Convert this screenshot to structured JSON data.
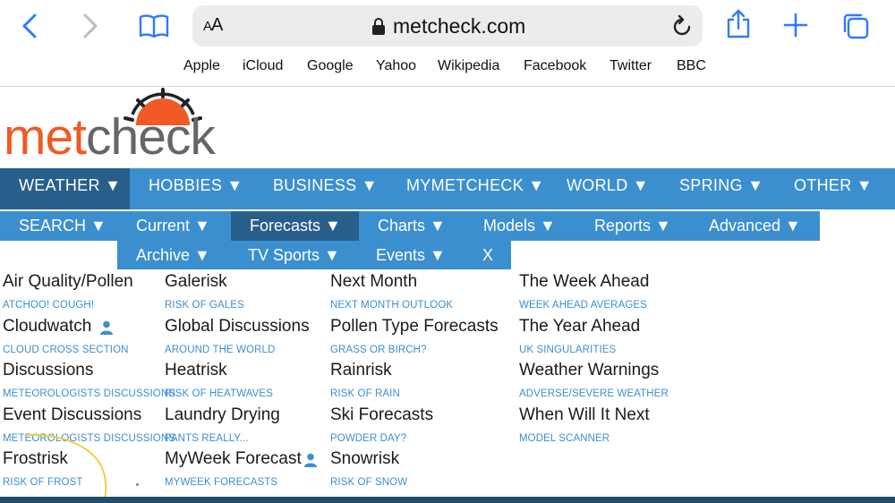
{
  "browser": {
    "url_display": "metcheck.com",
    "text_size_label": "AA",
    "favorites": [
      "Apple",
      "iCloud",
      "Google",
      "Yahoo",
      "Wikipedia",
      "Facebook",
      "Twitter",
      "BBC"
    ]
  },
  "site": {
    "logo": {
      "part1": "met",
      "part2": "check"
    },
    "nav_primary": [
      "WEATHER ▼",
      "HOBBIES ▼",
      "BUSINESS ▼",
      "MYMETCHECK ▼",
      "WORLD ▼",
      "SPRING ▼",
      "OTHER ▼"
    ],
    "nav_secondary_row1": [
      "SEARCH ▼",
      "Current ▼",
      "Forecasts ▼",
      "Charts ▼",
      "Models ▼",
      "Reports ▼",
      "Advanced ▼"
    ],
    "nav_secondary_row2": [
      "Archive ▼",
      "TV Sports ▼",
      "Events ▼",
      "X"
    ],
    "menu": {
      "col1": [
        {
          "title": "Air Quality/Pollen",
          "sub": "ATCHOO! COUGH!"
        },
        {
          "title": "Cloudwatch",
          "sub": "CLOUD CROSS SECTION"
        },
        {
          "title": "Discussions",
          "sub": "METEOROLOGISTS DISCUSSIONS"
        },
        {
          "title": "Event Discussions",
          "sub": "METEOROLOGISTS DISCUSSIONS"
        },
        {
          "title": "Frostrisk",
          "sub": "RISK OF FROST"
        }
      ],
      "col2": [
        {
          "title": "Galerisk",
          "sub": "RISK OF GALES"
        },
        {
          "title": "Global Discussions",
          "sub": "AROUND THE WORLD"
        },
        {
          "title": "Heatrisk",
          "sub": "RISK OF HEATWAVES"
        },
        {
          "title": "Laundry Drying",
          "sub": "PANTS REALLY..."
        },
        {
          "title": "MyWeek Forecast",
          "sub": "MYWEEK FORECASTS"
        }
      ],
      "col3": [
        {
          "title": "Next Month",
          "sub": "NEXT MONTH OUTLOOK"
        },
        {
          "title": "Pollen Type Forecasts",
          "sub": "GRASS OR BIRCH?"
        },
        {
          "title": "Rainrisk",
          "sub": "RISK OF RAIN"
        },
        {
          "title": "Ski Forecasts",
          "sub": "POWDER DAY?"
        },
        {
          "title": "Snowrisk",
          "sub": "RISK OF SNOW"
        }
      ],
      "col4": [
        {
          "title": "The Week Ahead",
          "sub": "WEEK AHEAD AVERAGES"
        },
        {
          "title": "The Year Ahead",
          "sub": "UK SINGULARITIES"
        },
        {
          "title": "Weather Warnings",
          "sub": "ADVERSE/SEVERE WEATHER"
        },
        {
          "title": "When Will It Next",
          "sub": "MODEL SCANNER"
        }
      ]
    }
  },
  "colors": {
    "nav_blue": "#3c8fcf",
    "nav_active": "#285e8a",
    "logo_orange": "#f15a24",
    "logo_grey": "#666666",
    "ios_blue": "#2f7cf6"
  }
}
